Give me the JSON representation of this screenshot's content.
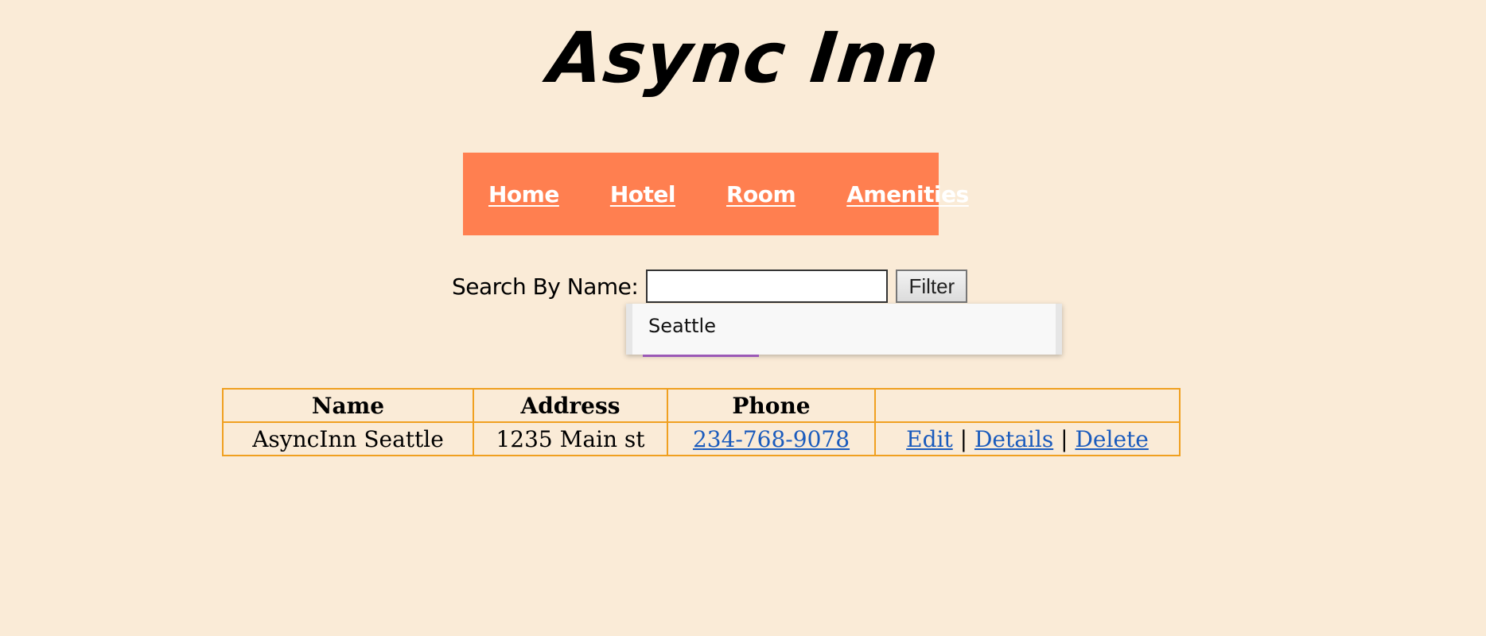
{
  "site": {
    "title": "Async Inn"
  },
  "nav": {
    "items": [
      {
        "label": "Home"
      },
      {
        "label": "Hotel"
      },
      {
        "label": "Room"
      },
      {
        "label": "Amenities"
      }
    ]
  },
  "search": {
    "label": "Search By Name:",
    "value": "",
    "placeholder": "",
    "button_label": "Filter",
    "suggestions": [
      "Seattle"
    ]
  },
  "table": {
    "headers": [
      "Name",
      "Address",
      "Phone",
      ""
    ],
    "rows": [
      {
        "name": "AsyncInn Seattle",
        "address": "1235 Main st",
        "phone": "234-768-9078",
        "actions": {
          "edit": "Edit",
          "details": "Details",
          "delete": "Delete",
          "separator": "|"
        }
      }
    ]
  },
  "colors": {
    "background": "#faebd7",
    "nav_background": "#ff7f50",
    "table_border": "#f0a020",
    "link": "#1a5bbd"
  }
}
